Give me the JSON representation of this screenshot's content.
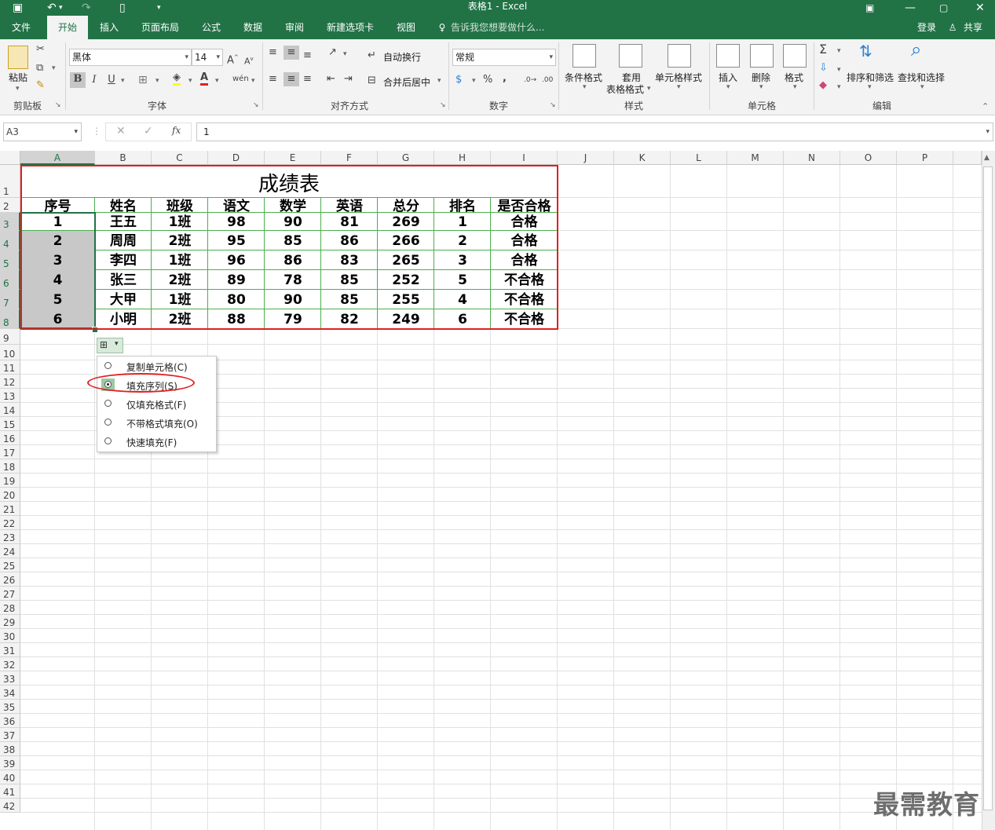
{
  "titlebar": {
    "title": "表格1 - Excel",
    "save_icon": "save-icon",
    "undo_icon": "undo-icon",
    "redo_icon": "redo-icon",
    "new_icon": "new-doc-icon"
  },
  "tabs": [
    "文件",
    "开始",
    "插入",
    "页面布局",
    "公式",
    "数据",
    "审阅",
    "新建选项卡",
    "视图"
  ],
  "active_tab": "开始",
  "tell_me": "告诉我您想要做什么...",
  "signin": "登录",
  "share": "共享",
  "ribbon": {
    "clipboard": {
      "paste": "粘贴",
      "label": "剪贴板"
    },
    "font": {
      "name": "黑体",
      "size": "14",
      "bold": "B",
      "italic": "I",
      "underline": "U",
      "grow": "A",
      "shrink": "A",
      "label": "字体",
      "wen": "wén"
    },
    "alignment": {
      "wrap": "自动换行",
      "merge": "合并后居中",
      "label": "对齐方式"
    },
    "number": {
      "format": "常规",
      "percent": "%",
      "comma": ",",
      "label": "数字"
    },
    "styles": {
      "conditional": "条件格式",
      "table": "套用",
      "table2": "表格格式",
      "cell": "单元格样式",
      "label": "样式"
    },
    "cells": {
      "insert": "插入",
      "delete": "删除",
      "format": "格式",
      "label": "单元格"
    },
    "editing": {
      "sort": "排序和筛选",
      "find": "查找和选择",
      "label": "编辑"
    }
  },
  "formula_bar": {
    "name_box": "A3",
    "fx": "fx",
    "value": "1"
  },
  "columns": [
    "A",
    "B",
    "C",
    "D",
    "E",
    "F",
    "G",
    "H",
    "I",
    "J",
    "K",
    "L",
    "M",
    "N",
    "O",
    "P"
  ],
  "rows": [
    "1",
    "2",
    "3",
    "4",
    "5",
    "6",
    "7",
    "8",
    "9",
    "10",
    "11",
    "12",
    "13",
    "14",
    "15",
    "16",
    "17",
    "18",
    "19",
    "20",
    "21",
    "22",
    "23",
    "24",
    "25",
    "26",
    "27",
    "28",
    "29",
    "30",
    "31",
    "32",
    "33",
    "34",
    "35",
    "36",
    "37",
    "38",
    "39",
    "40",
    "41",
    "42"
  ],
  "sheet": {
    "title": "成绩表",
    "headers": [
      "序号",
      "姓名",
      "班级",
      "语文",
      "数学",
      "英语",
      "总分",
      "排名",
      "是否合格"
    ],
    "data": [
      [
        "1",
        "王五",
        "1班",
        "98",
        "90",
        "81",
        "269",
        "1",
        "合格"
      ],
      [
        "2",
        "周周",
        "2班",
        "95",
        "85",
        "86",
        "266",
        "2",
        "合格"
      ],
      [
        "3",
        "李四",
        "1班",
        "96",
        "86",
        "83",
        "265",
        "3",
        "合格"
      ],
      [
        "4",
        "张三",
        "2班",
        "89",
        "78",
        "85",
        "252",
        "5",
        "不合格"
      ],
      [
        "5",
        "大甲",
        "1班",
        "80",
        "90",
        "85",
        "255",
        "4",
        "不合格"
      ],
      [
        "6",
        "小明",
        "2班",
        "88",
        "79",
        "82",
        "249",
        "6",
        "不合格"
      ]
    ]
  },
  "autofill_menu": {
    "items": [
      "复制单元格(C)",
      "填充序列(S)",
      "仅填充格式(F)",
      "不带格式填充(O)",
      "快速填充(F)"
    ],
    "selected_index": 1
  },
  "watermark": "最需教育",
  "colors": {
    "excel_green": "#217346",
    "selection_border": "#217346",
    "highlight_red": "#e02020",
    "selected_fill": "#c8c8c8"
  }
}
